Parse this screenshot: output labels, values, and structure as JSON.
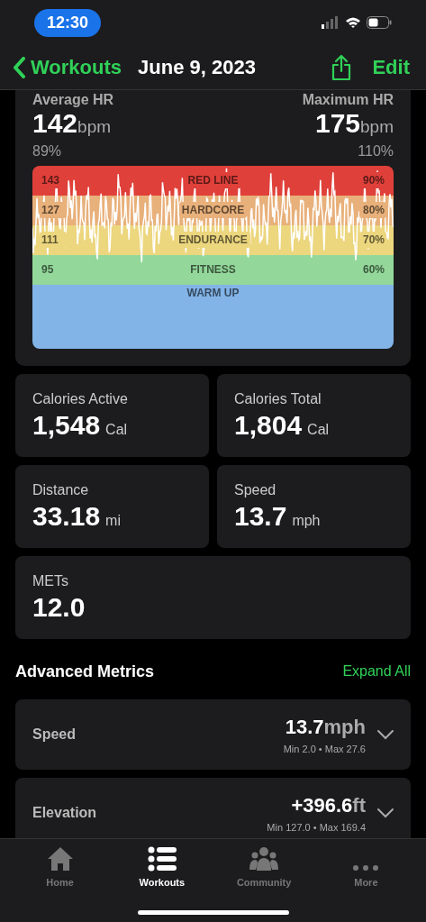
{
  "status_bar": {
    "time": "12:30"
  },
  "nav": {
    "back": "Workouts",
    "title": "June 9, 2023",
    "edit": "Edit"
  },
  "heart_rate": {
    "average_label": "Average HR",
    "average_value": "142",
    "average_unit": "bpm",
    "average_pct": "89%",
    "max_label": "Maximum HR",
    "max_value": "175",
    "max_unit": "bpm",
    "max_pct": "110%",
    "zones": [
      {
        "name": "RED LINE",
        "bpm": "143",
        "pct": "90%",
        "color": "#e0403a"
      },
      {
        "name": "HARDCORE",
        "bpm": "127",
        "pct": "80%",
        "color": "#e8b07a"
      },
      {
        "name": "ENDURANCE",
        "bpm": "111",
        "pct": "70%",
        "color": "#ecd67e"
      },
      {
        "name": "FITNESS",
        "bpm": "95",
        "pct": "60%",
        "color": "#93d89a"
      },
      {
        "name": "WARM UP",
        "color": "#82b4e8"
      }
    ]
  },
  "stats": [
    {
      "label": "Calories Active",
      "value": "1,548",
      "unit": "Cal"
    },
    {
      "label": "Calories Total",
      "value": "1,804",
      "unit": "Cal"
    },
    {
      "label": "Distance",
      "value": "33.18",
      "unit": "mi"
    },
    {
      "label": "Speed",
      "value": "13.7",
      "unit": "mph"
    },
    {
      "label": "METs",
      "value": "12.0"
    }
  ],
  "advanced": {
    "title": "Advanced Metrics",
    "action": "Expand All",
    "metrics": [
      {
        "label": "Speed",
        "value": "13.7",
        "unit": "mph",
        "range": "Min 2.0 • Max 27.6",
        "expanded": false
      },
      {
        "label": "Elevation",
        "value": "+396.6",
        "unit": "ft",
        "range": "Min 127.0 • Max 169.4",
        "expanded": false
      }
    ]
  },
  "tabs": [
    {
      "label": "Home",
      "kind": "home",
      "selected": false
    },
    {
      "label": "Workouts",
      "kind": "list",
      "selected": true
    },
    {
      "label": "Community",
      "kind": "people",
      "selected": false
    },
    {
      "label": "More",
      "kind": "dots",
      "selected": false
    }
  ]
}
